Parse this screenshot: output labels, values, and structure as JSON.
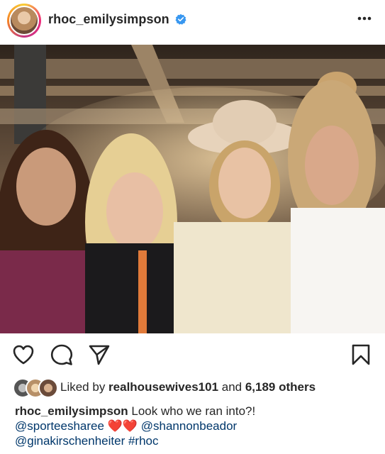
{
  "post": {
    "username": "rhoc_emilysimpson",
    "verified": true,
    "icons": {
      "verified": "verified-badge-icon",
      "more": "more-options-icon",
      "like": "heart-icon",
      "comment": "comment-icon",
      "share": "share-icon",
      "save": "bookmark-icon"
    },
    "photo": {
      "description_icon": "photo"
    },
    "likes": {
      "prefix": "Liked by ",
      "top_liker": "realhousewives101",
      "middle": " and ",
      "others": "6,189 others"
    },
    "caption": {
      "author": "rhoc_emilysimpson",
      "text": " Look who we ran into?!",
      "mention1": "@sporteesharee",
      "hearts": "❤️❤️",
      "mention2": "@shannonbeador",
      "mention3": "@ginakirschenheiter",
      "hashtag": "#rhoc"
    },
    "colors": {
      "verified_blue": "#3897f0",
      "link": "#00376b",
      "text": "#262626"
    }
  }
}
